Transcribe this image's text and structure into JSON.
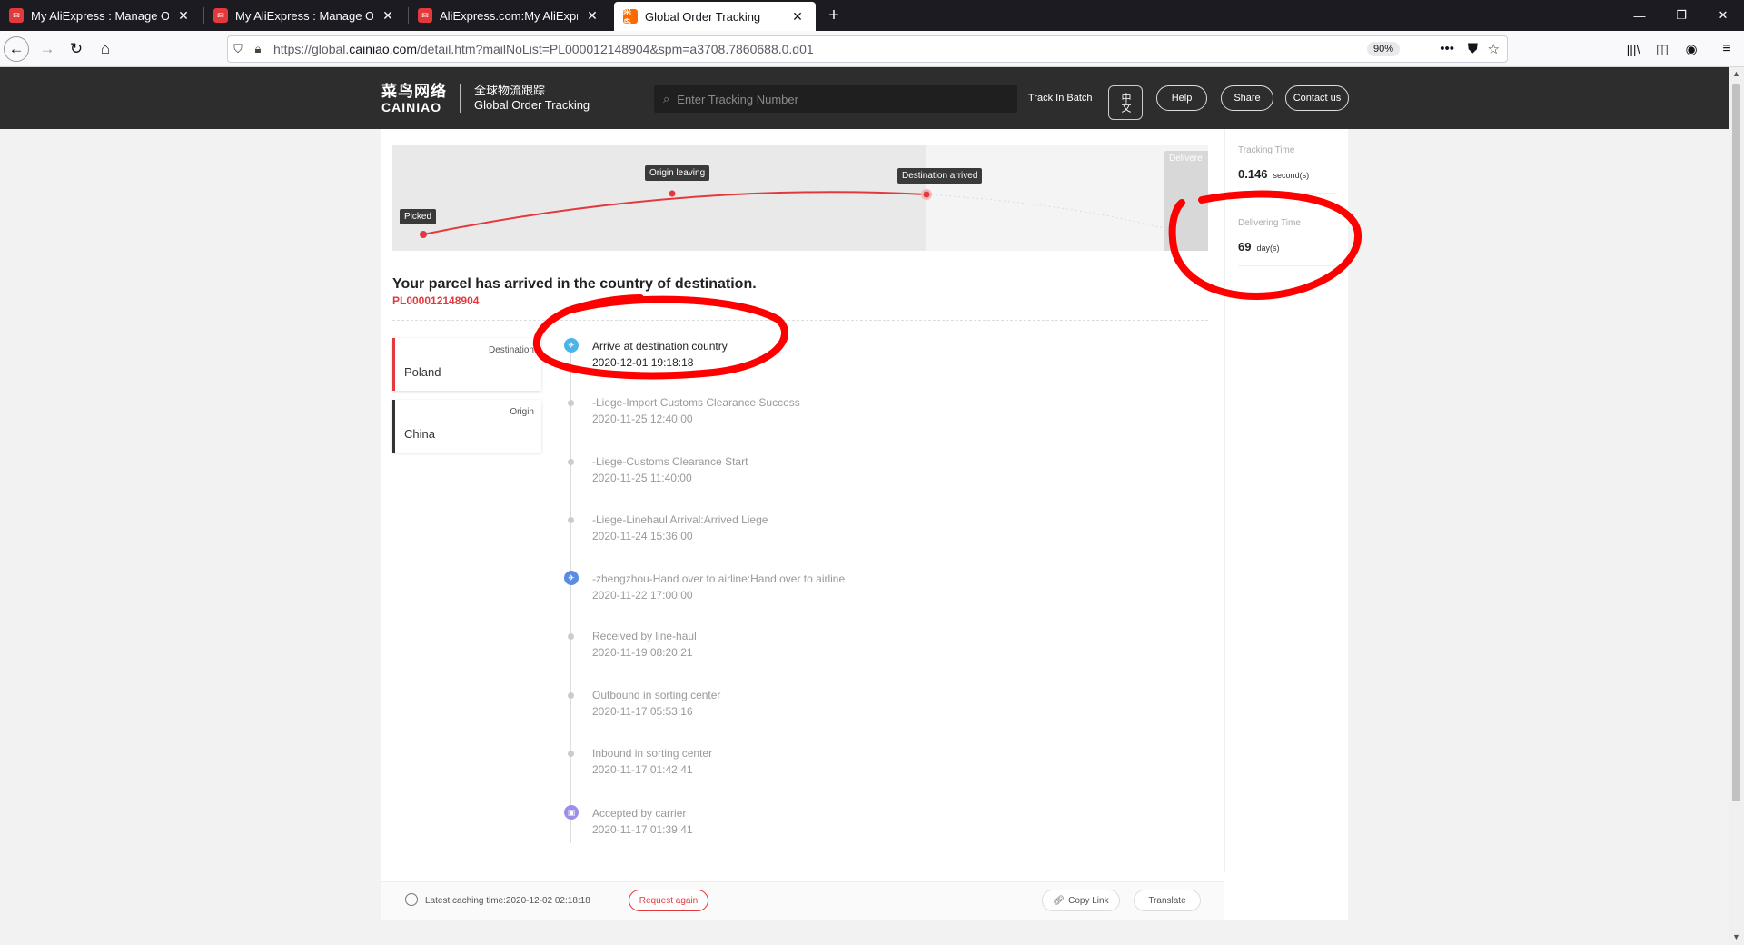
{
  "browser": {
    "tabs": [
      {
        "label": "My AliExpress : Manage Orders"
      },
      {
        "label": "My AliExpress : Manage Orders"
      },
      {
        "label": "AliExpress.com:My AliExpress"
      },
      {
        "label": "Global Order Tracking",
        "favicon_text": "菜鸟"
      }
    ],
    "url_prefix": "https://global.",
    "url_domain": "cainiao.com",
    "url_suffix": "/detail.htm?mailNoList=PL000012148904&spm=a3708.7860688.0.d01",
    "zoom": "90%"
  },
  "header": {
    "logo_cn": "菜鸟网络",
    "logo_en": "CAINIAO",
    "sub_cn": "全球物流跟踪",
    "sub_en": "Global Order Tracking",
    "search_placeholder": "Enter Tracking Number",
    "track_in_batch": "Track In Batch",
    "lang_label": "中文",
    "help": "Help",
    "share": "Share",
    "contact": "Contact us"
  },
  "progress": {
    "stages": {
      "picked": "Picked",
      "origin_leaving": "Origin leaving",
      "destination_arrived": "Destination arrived",
      "delivered": "Delivere"
    }
  },
  "parcel": {
    "status_headline": "Your parcel has arrived in the country of destination.",
    "tracking_number": "PL000012148904",
    "destination_label": "Destination",
    "destination": "Poland",
    "origin_label": "Origin",
    "origin": "China"
  },
  "events": [
    {
      "text": "Arrive at destination country",
      "time": "2020-12-01 19:18:18"
    },
    {
      "text": "-Liege-Import Customs Clearance Success",
      "time": "2020-11-25 12:40:00"
    },
    {
      "text": "-Liege-Customs Clearance Start",
      "time": "2020-11-25 11:40:00"
    },
    {
      "text": "-Liege-Linehaul Arrival:Arrived Liege",
      "time": "2020-11-24 15:36:00"
    },
    {
      "text": "-zhengzhou-Hand over to airline:Hand over to airline",
      "time": "2020-11-22 17:00:00"
    },
    {
      "text": "Received by line-haul",
      "time": "2020-11-19 08:20:21"
    },
    {
      "text": "Outbound in sorting center",
      "time": "2020-11-17 05:53:16"
    },
    {
      "text": "Inbound in sorting center",
      "time": "2020-11-17 01:42:41"
    },
    {
      "text": "Accepted by carrier",
      "time": "2020-11-17 01:39:41"
    }
  ],
  "sidebar": {
    "tracking_time_label": "Tracking Time",
    "tracking_time_value": "0.146",
    "tracking_time_unit": "second(s)",
    "delivering_time_label": "Delivering Time",
    "delivering_time_value": "69",
    "delivering_time_unit": "day(s)"
  },
  "footer": {
    "caching_time": "Latest caching time:2020-12-02 02:18:18",
    "request_again": "Request again",
    "copy_link": "Copy Link",
    "translate": "Translate"
  },
  "colors": {
    "accent_red": "#e4393c",
    "header_bg": "#2d2d2d",
    "annotation_red": "#ff0000"
  }
}
